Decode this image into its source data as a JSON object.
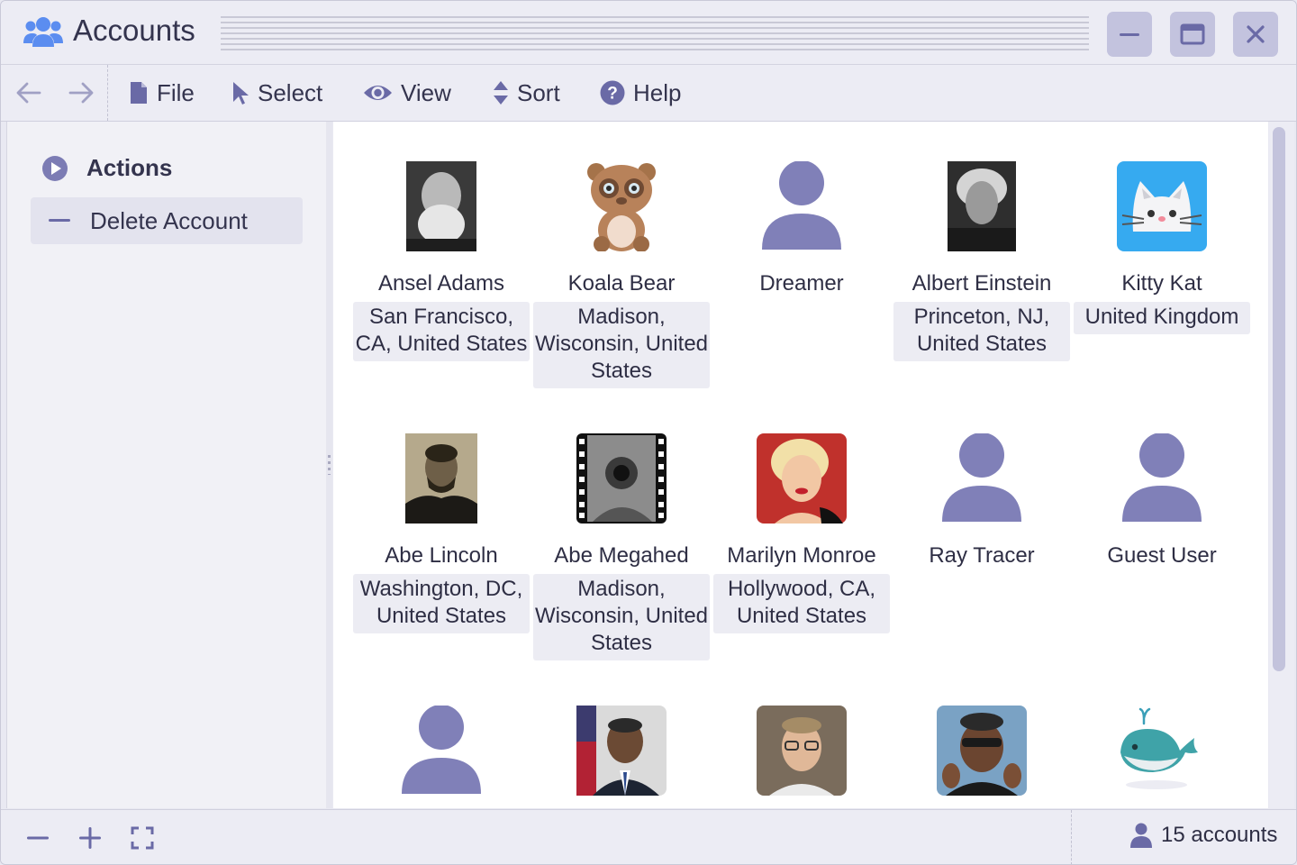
{
  "window": {
    "title": "Accounts",
    "app_icon": "users-icon",
    "controls": [
      "minimize",
      "maximize",
      "close"
    ]
  },
  "toolbar": {
    "back_icon": "arrow-left-icon",
    "forward_icon": "arrow-right-icon",
    "menus": [
      {
        "label": "File",
        "icon": "file-icon"
      },
      {
        "label": "Select",
        "icon": "cursor-icon"
      },
      {
        "label": "View",
        "icon": "eye-icon"
      },
      {
        "label": "Sort",
        "icon": "sort-icon"
      },
      {
        "label": "Help",
        "icon": "help-icon"
      }
    ]
  },
  "sidebar": {
    "header": "Actions",
    "items": [
      {
        "label": "Delete Account",
        "icon": "minus-icon"
      }
    ]
  },
  "accounts": [
    {
      "name": "Ansel Adams",
      "location": "San Francisco, CA, United States",
      "avatar": "photo"
    },
    {
      "name": "Koala Bear",
      "location": "Madison, Wisconsin, United States",
      "avatar": "koala"
    },
    {
      "name": "Dreamer",
      "location": "",
      "avatar": "generic"
    },
    {
      "name": "Albert Einstein",
      "location": "Princeton, NJ, United States",
      "avatar": "photo"
    },
    {
      "name": "Kitty Kat",
      "location": "United Kingdom",
      "avatar": "cat"
    },
    {
      "name": "Abe Lincoln",
      "location": "Washington, DC, United States",
      "avatar": "photo"
    },
    {
      "name": "Abe Megahed",
      "location": "Madison, Wisconsin, United States",
      "avatar": "film"
    },
    {
      "name": "Marilyn Monroe",
      "location": "Hollywood, CA, United States",
      "avatar": "photo"
    },
    {
      "name": "Ray Tracer",
      "location": "",
      "avatar": "generic"
    },
    {
      "name": "Guest User",
      "location": "",
      "avatar": "generic"
    },
    {
      "name": "",
      "location": "",
      "avatar": "generic"
    },
    {
      "name": "",
      "location": "",
      "avatar": "photo"
    },
    {
      "name": "",
      "location": "",
      "avatar": "photo"
    },
    {
      "name": "",
      "location": "",
      "avatar": "photo"
    },
    {
      "name": "",
      "location": "",
      "avatar": "whale"
    }
  ],
  "status": {
    "count_label": "15 accounts",
    "controls": [
      "zoom-out",
      "zoom-in",
      "fullscreen"
    ]
  },
  "colors": {
    "accent": "#7c7cb4",
    "window_button": "#c3c3de",
    "generic_avatar": "#8080b8",
    "app_icon": "#5b8df0"
  }
}
